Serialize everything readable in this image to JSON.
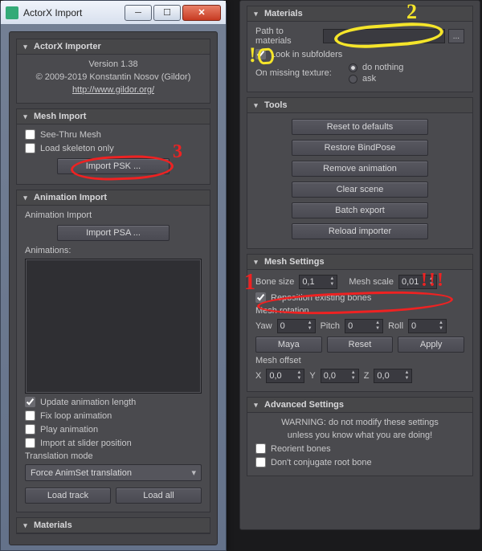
{
  "window": {
    "title": "ActorX Import"
  },
  "header": {
    "title": "ActorX Importer",
    "version": "Version 1.38",
    "copyright": "© 2009-2019 Konstantin Nosov (Gildor)",
    "url": "http://www.gildor.org/"
  },
  "mesh_import": {
    "title": "Mesh Import",
    "see_thru": "See-Thru Mesh",
    "skeleton_only": "Load skeleton only",
    "import_psk": "Import PSK ..."
  },
  "anim_import": {
    "title": "Animation Import",
    "label": "Animation Import",
    "import_psa": "Import PSA ...",
    "anim_label": "Animations:",
    "update_len": "Update animation length",
    "fix_loop": "Fix loop animation",
    "play": "Play animation",
    "at_slider": "Import at slider position",
    "trans_mode_label": "Translation mode",
    "trans_mode_value": "Force AnimSet translation",
    "load_track": "Load track",
    "load_all": "Load all"
  },
  "left_materials": {
    "title": "Materials"
  },
  "materials": {
    "title": "Materials",
    "path_label": "Path to materials",
    "path_value": "",
    "look_sub": "Look in subfolders",
    "on_missing_label": "On missing texture:",
    "opt_nothing": "do nothing",
    "opt_ask": "ask"
  },
  "tools": {
    "title": "Tools",
    "reset_defaults": "Reset to defaults",
    "restore_bind": "Restore BindPose",
    "remove_anim": "Remove animation",
    "clear_scene": "Clear scene",
    "batch_export": "Batch export",
    "reload": "Reload importer"
  },
  "mesh_settings": {
    "title": "Mesh Settings",
    "bone_size_label": "Bone size",
    "bone_size_value": "0,1",
    "mesh_scale_label": "Mesh scale",
    "mesh_scale_value": "0,01",
    "reposition": "Reposition existing bones",
    "rotation_label": "Mesh rotation",
    "yaw_label": "Yaw",
    "yaw_val": "0",
    "pitch_label": "Pitch",
    "pitch_val": "0",
    "roll_label": "Roll",
    "roll_val": "0",
    "maya": "Maya",
    "reset": "Reset",
    "apply": "Apply",
    "offset_label": "Mesh offset",
    "x_label": "X",
    "x_val": "0,0",
    "y_label": "Y",
    "y_val": "0,0",
    "z_label": "Z",
    "z_val": "0,0"
  },
  "advanced": {
    "title": "Advanced Settings",
    "warning1": "WARNING: do not modify these settings",
    "warning2": "unless you know what you are doing!",
    "reorient": "Reorient bones",
    "conjugate": "Don't conjugate root bone"
  },
  "annotations": {
    "one": "1",
    "two": "2",
    "three": "3",
    "bang": "!!!",
    "excl": "!"
  }
}
